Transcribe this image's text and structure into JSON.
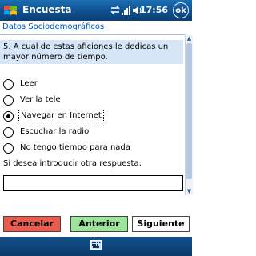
{
  "window": {
    "title": "Encuesta",
    "time": "17:56",
    "ok_label": "ok",
    "start_icon": "windows-flag-icon",
    "status_icons": [
      "connectivity-icon",
      "signal-icon",
      "volume-icon"
    ]
  },
  "main": {
    "section_link": "Datos Sociodemográficos",
    "question": "5. A cual de estas aficiones le dedicas un mayor número de tiempo.",
    "options": [
      {
        "label": "Leer",
        "selected": false
      },
      {
        "label": "Ver la tele",
        "selected": false
      },
      {
        "label": "Navegar en Internet",
        "selected": true
      },
      {
        "label": "Escuchar la radio",
        "selected": false
      },
      {
        "label": "No tengo tiempo para nada",
        "selected": false
      }
    ],
    "other_label": "Si desea introducir otra respuesta:",
    "other_value": ""
  },
  "buttons": {
    "cancel": "Cancelar",
    "prev": "Anterior",
    "next": "Siguiente"
  },
  "colors": {
    "titlebar": "#0d4f8f",
    "question_bg": "#d6e6f6",
    "cancel": "#ee5b4d",
    "prev": "#9be59b",
    "next": "#ffffff"
  },
  "bottom": {
    "keyboard_icon": "keyboard-icon"
  }
}
